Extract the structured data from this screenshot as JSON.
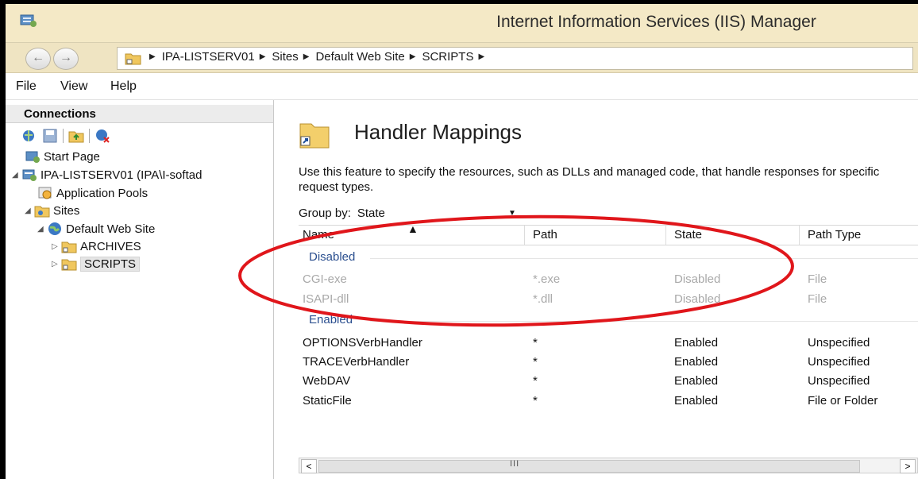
{
  "window": {
    "title": "Internet Information Services (IIS) Manager"
  },
  "addressbar": {
    "crumbs": [
      "IPA-LISTSERV01",
      "Sites",
      "Default Web Site",
      "SCRIPTS"
    ]
  },
  "menu": {
    "file": "File",
    "view": "View",
    "help": "Help"
  },
  "connections": {
    "title": "Connections",
    "tree": {
      "start_page": "Start Page",
      "server": "IPA-LISTSERV01 (IPA\\I-softad",
      "app_pools": "Application Pools",
      "sites": "Sites",
      "default_site": "Default Web Site",
      "archives": "ARCHIVES",
      "scripts": "SCRIPTS"
    }
  },
  "feature": {
    "title": "Handler Mappings",
    "description": "Use this feature to specify the resources, such as DLLs and managed code, that handle responses for specific request types.",
    "group_by_label": "Group by:",
    "group_by_value": "State"
  },
  "grid": {
    "columns": [
      "Name",
      "Path",
      "State",
      "Path Type"
    ],
    "groups": {
      "disabled": "Disabled",
      "enabled": "Enabled"
    },
    "disabled_rows": [
      {
        "name": "CGI-exe",
        "path": "*.exe",
        "state": "Disabled",
        "path_type": "File"
      },
      {
        "name": "ISAPI-dll",
        "path": "*.dll",
        "state": "Disabled",
        "path_type": "File"
      }
    ],
    "enabled_rows": [
      {
        "name": "OPTIONSVerbHandler",
        "path": "*",
        "state": "Enabled",
        "path_type": "Unspecified"
      },
      {
        "name": "TRACEVerbHandler",
        "path": "*",
        "state": "Enabled",
        "path_type": "Unspecified"
      },
      {
        "name": "WebDAV",
        "path": "*",
        "state": "Enabled",
        "path_type": "Unspecified"
      },
      {
        "name": "StaticFile",
        "path": "*",
        "state": "Enabled",
        "path_type": "File or Folder"
      }
    ]
  },
  "scrollbar": {
    "left_arrow": "<",
    "grip": "III",
    "right_arrow": ">"
  },
  "colors": {
    "titlebar": "#f4e9c6",
    "annotation": "#e0161b",
    "group_label": "#2b4f8f"
  },
  "icons": [
    "app-icon",
    "back-icon",
    "forward-icon",
    "server-icon",
    "globe-icon",
    "folder-icon"
  ]
}
